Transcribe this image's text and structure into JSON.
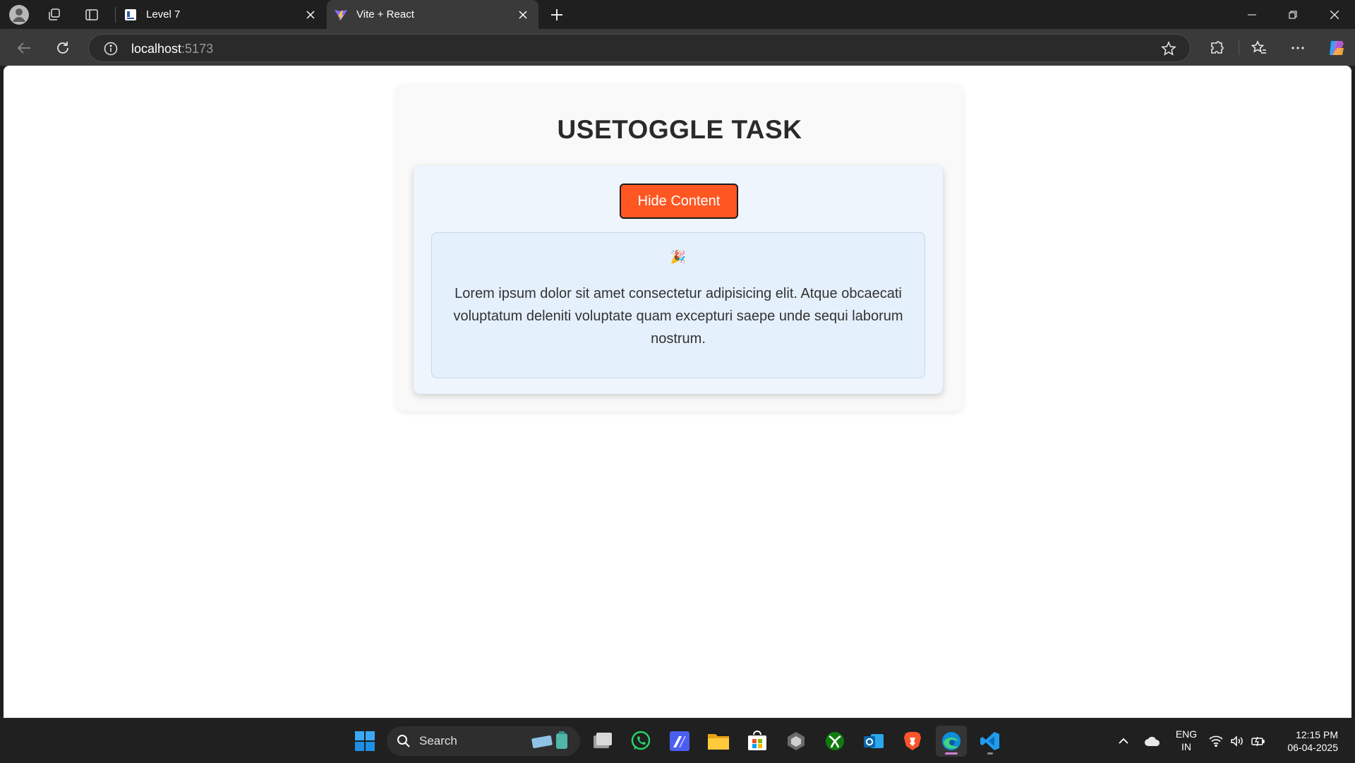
{
  "browser": {
    "tabs": [
      {
        "title": "Level 7",
        "favicon": "document-icon",
        "active": false
      },
      {
        "title": "Vite + React",
        "favicon": "vite-icon",
        "active": true
      }
    ],
    "url_host": "localhost",
    "url_port": ":5173"
  },
  "page": {
    "title": "USETOGGLE TASK",
    "toggle_label": "Hide Content",
    "emoji": "🎉",
    "content_text": "Lorem ipsum dolor sit amet consectetur adipisicing elit. Atque obcaecati voluptatum deleniti voluptate quam excepturi saepe unde sequi laborum nostrum."
  },
  "colors": {
    "button_bg": "#ff5722",
    "content_bg": "#e4f0fb",
    "card_bg": "#eef5fc"
  },
  "taskbar": {
    "search_label": "Search",
    "language": "ENG",
    "region": "IN",
    "time": "12:15 PM",
    "date": "06-04-2025",
    "apps": [
      "start-icon",
      "task-view-icon",
      "whatsapp-icon",
      "editor-icon",
      "file-explorer-icon",
      "store-icon",
      "unity-icon",
      "xbox-icon",
      "outlook-icon",
      "brave-icon",
      "edge-icon",
      "vscode-icon"
    ]
  }
}
